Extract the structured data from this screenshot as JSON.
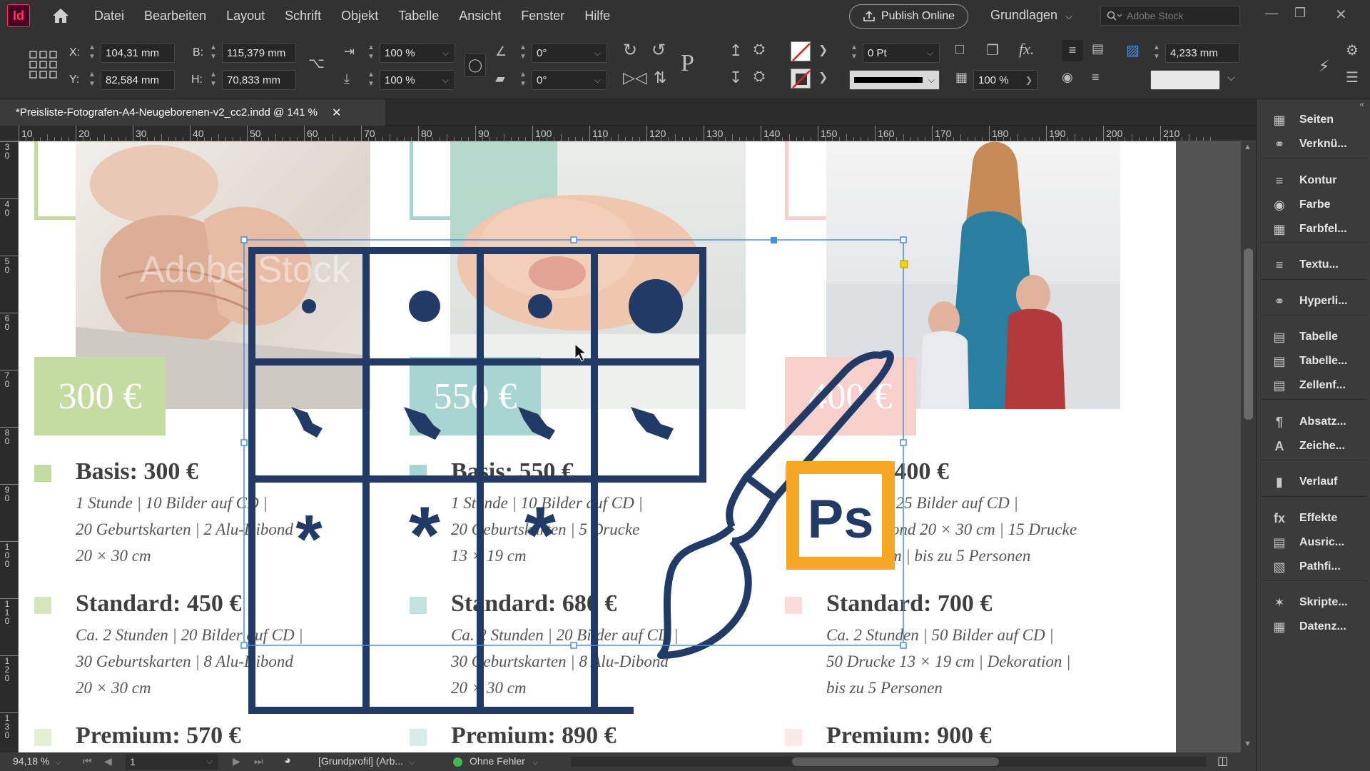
{
  "app": {
    "logo": "Id"
  },
  "menu": [
    "Datei",
    "Bearbeiten",
    "Layout",
    "Schrift",
    "Objekt",
    "Tabelle",
    "Ansicht",
    "Fenster",
    "Hilfe"
  ],
  "publish_label": "Publish Online",
  "workspace": "Grundlagen",
  "stock_placeholder": "Adobe Stock",
  "control": {
    "x_label": "X:",
    "x": "104,31 mm",
    "y_label": "Y:",
    "y": "82,584 mm",
    "w_label": "B:",
    "w": "115,379 mm",
    "h_label": "H:",
    "h": "70,833 mm",
    "scale_x": "100 %",
    "scale_y": "100 %",
    "rotate": "0°",
    "shear": "0°",
    "stroke_weight": "0 Pt",
    "opacity": "100 %",
    "gap": "4,233 mm"
  },
  "document_tab": "*Preisliste-Fotografen-A4-Neugeborenen-v2_cc2.indd @ 141 %",
  "ruler_ticks": [
    "10",
    "20",
    "30",
    "40",
    "50",
    "60",
    "70",
    "80",
    "90",
    "100",
    "110",
    "120",
    "130",
    "140",
    "150",
    "160",
    "170",
    "180",
    "190",
    "200",
    "210"
  ],
  "ruler_v": [
    "3\n0",
    "4\n0",
    "5\n0",
    "6\n0",
    "7\n0",
    "8\n0",
    "9\n0",
    "1\n0\n0",
    "1\n1\n0",
    "1\n2\n0",
    "1\n3\n0"
  ],
  "watermark": "Adobe Stock",
  "columns": [
    {
      "accent": "#c5dca0",
      "price_tag": "300 €",
      "packages": [
        {
          "title": "Basis: 300 €",
          "lines": [
            "1 Stunde | 10 Bilder auf CD |",
            "20 Geburtskarten | 2 Alu-Dibond",
            "20 × 30 cm"
          ]
        },
        {
          "title": "Standard: 450 €",
          "lines": [
            "Ca. 2 Stunden | 20 Bilder auf CD |",
            "30 Geburtskarten | 8 Alu-Dibond",
            "20 × 30 cm"
          ]
        },
        {
          "title": "Premium: 570 €",
          "lines": []
        }
      ]
    },
    {
      "accent": "#a8d5d1",
      "price_tag": "550 €",
      "packages": [
        {
          "title": "Basis: 550 €",
          "lines": [
            "1 Stunde | 10 Bilder auf CD |",
            "20 Geburtskarten | 5 Drucke",
            "13 × 19 cm"
          ]
        },
        {
          "title": "Standard: 680 €",
          "lines": [
            "Ca. 2 Stunden | 20 Bilder auf CD |",
            "30 Geburtskarten | 8 Alu-Dibond",
            "20 × 30 cm"
          ]
        },
        {
          "title": "Premium: 890 €",
          "lines": []
        }
      ]
    },
    {
      "accent": "#f7cfcb",
      "price_tag": "400 €",
      "packages": [
        {
          "title": "Basis: 400 €",
          "lines": [
            "1 Stunde | 25 Bilder auf CD |",
            "2 Alu-Dibond 20 × 30 cm | 15 Drucke",
            "13 × 19 cm | bis zu 5 Personen"
          ]
        },
        {
          "title": "Standard: 700 €",
          "lines": [
            "Ca. 2 Stunden | 50 Bilder auf CD |",
            "50 Drucke 13 × 19 cm | Dekoration |",
            "bis zu 5 Personen"
          ]
        },
        {
          "title": "Premium: 900 €",
          "lines": []
        }
      ]
    }
  ],
  "overlay": {
    "ps_label": "Ps",
    "grid_color": "#223a66",
    "ps_color": "#f5a623"
  },
  "status": {
    "zoom": "94,18 %",
    "page": "1",
    "profile": "[Grundprofil] (Arb...",
    "preflight": "Ohne Fehler"
  },
  "panels": [
    "Seiten",
    "Verknü...",
    "Kontur",
    "Farbe",
    "Farbfel...",
    "Textu...",
    "Hyperli...",
    "Tabelle",
    "Tabelle...",
    "Zellenf...",
    "Absatz...",
    "Zeiche...",
    "Verlauf",
    "Effekte",
    "Ausric...",
    "Pathfi...",
    "Skripte...",
    "Datenz..."
  ]
}
